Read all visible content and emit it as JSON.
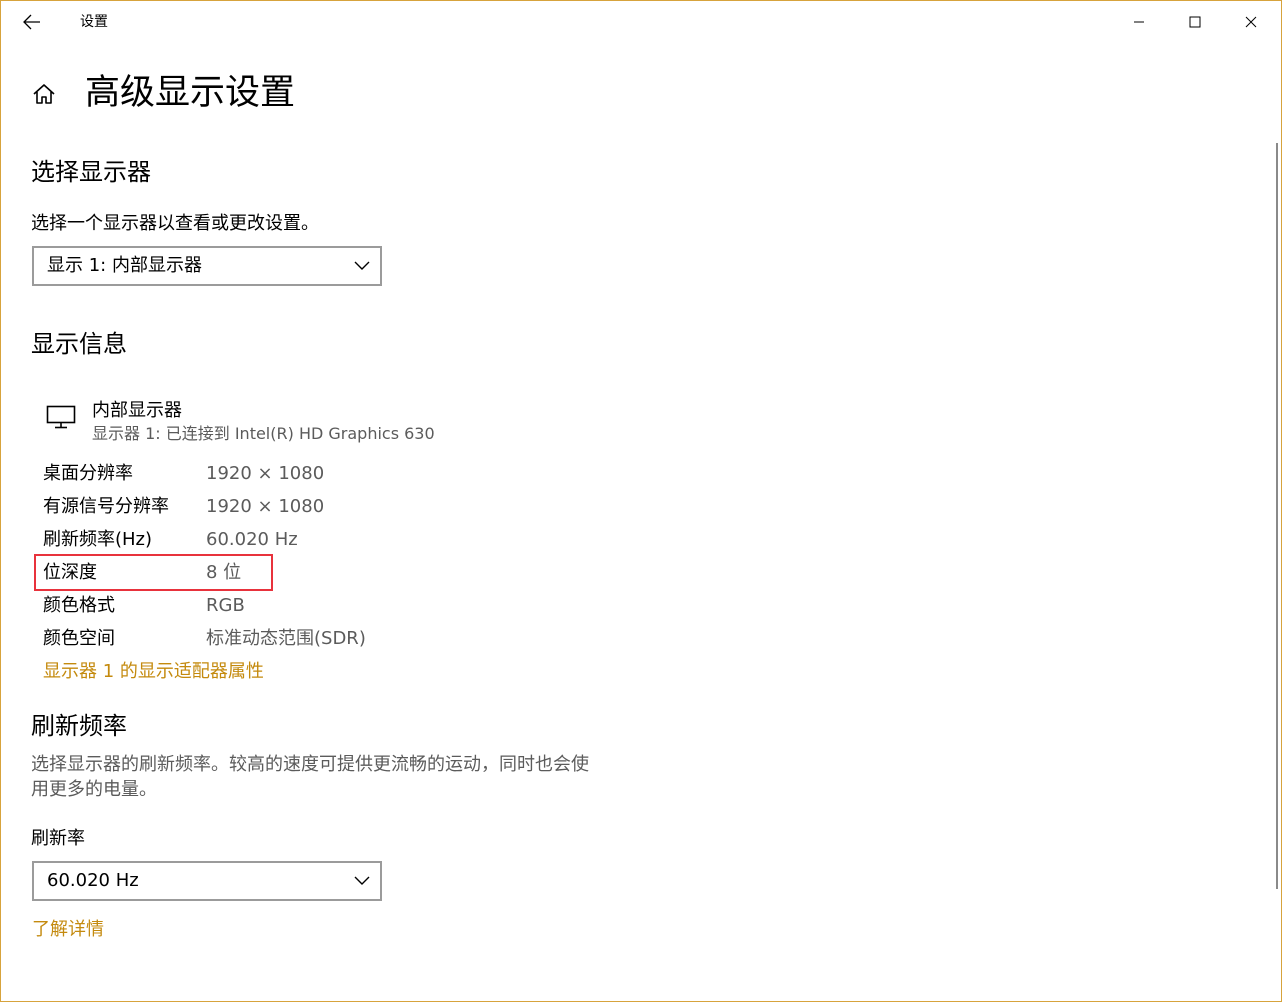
{
  "window": {
    "title": "设置"
  },
  "page": {
    "title": "高级显示设置"
  },
  "select_display": {
    "heading": "选择显示器",
    "description": "选择一个显示器以查看或更改设置。",
    "dropdown_value": "显示 1: 内部显示器"
  },
  "display_info": {
    "heading": "显示信息",
    "monitor_name": "内部显示器",
    "monitor_subtitle": "显示器 1: 已连接到 Intel(R) HD Graphics 630",
    "rows": [
      {
        "label": "桌面分辨率",
        "value": "1920 × 1080"
      },
      {
        "label": "有源信号分辨率",
        "value": "1920 × 1080"
      },
      {
        "label": "刷新频率(Hz)",
        "value": "60.020 Hz"
      },
      {
        "label": "位深度",
        "value": "8 位"
      },
      {
        "label": "颜色格式",
        "value": "RGB"
      },
      {
        "label": "颜色空间",
        "value": "标准动态范围(SDR)"
      }
    ],
    "adapter_link": "显示器 1 的显示适配器属性"
  },
  "refresh": {
    "heading": "刷新频率",
    "description": "选择显示器的刷新频率。较高的速度可提供更流畅的运动，同时也会使用更多的电量。",
    "field_label": "刷新率",
    "dropdown_value": "60.020 Hz",
    "learn_more_link": "了解详情"
  },
  "colors": {
    "accent_link": "#c48a0e",
    "highlight_border": "#e8323c",
    "window_border": "#d7a33c"
  }
}
